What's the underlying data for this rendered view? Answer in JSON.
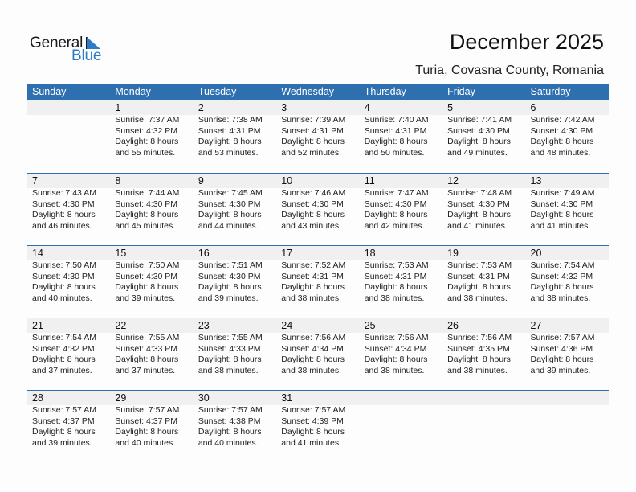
{
  "logo": {
    "word1": "General",
    "word2": "Blue"
  },
  "header": {
    "title": "December 2025",
    "location": "Turia, Covasna County, Romania"
  },
  "colors": {
    "accent": "#2e6fb0",
    "logo_blue": "#2a7bc8",
    "band": "#f0f0f0"
  },
  "weekdays": [
    "Sunday",
    "Monday",
    "Tuesday",
    "Wednesday",
    "Thursday",
    "Friday",
    "Saturday"
  ],
  "weeks": [
    [
      null,
      {
        "day": "1",
        "sunrise": "Sunrise: 7:37 AM",
        "sunset": "Sunset: 4:32 PM",
        "daylight1": "Daylight: 8 hours",
        "daylight2": "and 55 minutes."
      },
      {
        "day": "2",
        "sunrise": "Sunrise: 7:38 AM",
        "sunset": "Sunset: 4:31 PM",
        "daylight1": "Daylight: 8 hours",
        "daylight2": "and 53 minutes."
      },
      {
        "day": "3",
        "sunrise": "Sunrise: 7:39 AM",
        "sunset": "Sunset: 4:31 PM",
        "daylight1": "Daylight: 8 hours",
        "daylight2": "and 52 minutes."
      },
      {
        "day": "4",
        "sunrise": "Sunrise: 7:40 AM",
        "sunset": "Sunset: 4:31 PM",
        "daylight1": "Daylight: 8 hours",
        "daylight2": "and 50 minutes."
      },
      {
        "day": "5",
        "sunrise": "Sunrise: 7:41 AM",
        "sunset": "Sunset: 4:30 PM",
        "daylight1": "Daylight: 8 hours",
        "daylight2": "and 49 minutes."
      },
      {
        "day": "6",
        "sunrise": "Sunrise: 7:42 AM",
        "sunset": "Sunset: 4:30 PM",
        "daylight1": "Daylight: 8 hours",
        "daylight2": "and 48 minutes."
      }
    ],
    [
      {
        "day": "7",
        "sunrise": "Sunrise: 7:43 AM",
        "sunset": "Sunset: 4:30 PM",
        "daylight1": "Daylight: 8 hours",
        "daylight2": "and 46 minutes."
      },
      {
        "day": "8",
        "sunrise": "Sunrise: 7:44 AM",
        "sunset": "Sunset: 4:30 PM",
        "daylight1": "Daylight: 8 hours",
        "daylight2": "and 45 minutes."
      },
      {
        "day": "9",
        "sunrise": "Sunrise: 7:45 AM",
        "sunset": "Sunset: 4:30 PM",
        "daylight1": "Daylight: 8 hours",
        "daylight2": "and 44 minutes."
      },
      {
        "day": "10",
        "sunrise": "Sunrise: 7:46 AM",
        "sunset": "Sunset: 4:30 PM",
        "daylight1": "Daylight: 8 hours",
        "daylight2": "and 43 minutes."
      },
      {
        "day": "11",
        "sunrise": "Sunrise: 7:47 AM",
        "sunset": "Sunset: 4:30 PM",
        "daylight1": "Daylight: 8 hours",
        "daylight2": "and 42 minutes."
      },
      {
        "day": "12",
        "sunrise": "Sunrise: 7:48 AM",
        "sunset": "Sunset: 4:30 PM",
        "daylight1": "Daylight: 8 hours",
        "daylight2": "and 41 minutes."
      },
      {
        "day": "13",
        "sunrise": "Sunrise: 7:49 AM",
        "sunset": "Sunset: 4:30 PM",
        "daylight1": "Daylight: 8 hours",
        "daylight2": "and 41 minutes."
      }
    ],
    [
      {
        "day": "14",
        "sunrise": "Sunrise: 7:50 AM",
        "sunset": "Sunset: 4:30 PM",
        "daylight1": "Daylight: 8 hours",
        "daylight2": "and 40 minutes."
      },
      {
        "day": "15",
        "sunrise": "Sunrise: 7:50 AM",
        "sunset": "Sunset: 4:30 PM",
        "daylight1": "Daylight: 8 hours",
        "daylight2": "and 39 minutes."
      },
      {
        "day": "16",
        "sunrise": "Sunrise: 7:51 AM",
        "sunset": "Sunset: 4:30 PM",
        "daylight1": "Daylight: 8 hours",
        "daylight2": "and 39 minutes."
      },
      {
        "day": "17",
        "sunrise": "Sunrise: 7:52 AM",
        "sunset": "Sunset: 4:31 PM",
        "daylight1": "Daylight: 8 hours",
        "daylight2": "and 38 minutes."
      },
      {
        "day": "18",
        "sunrise": "Sunrise: 7:53 AM",
        "sunset": "Sunset: 4:31 PM",
        "daylight1": "Daylight: 8 hours",
        "daylight2": "and 38 minutes."
      },
      {
        "day": "19",
        "sunrise": "Sunrise: 7:53 AM",
        "sunset": "Sunset: 4:31 PM",
        "daylight1": "Daylight: 8 hours",
        "daylight2": "and 38 minutes."
      },
      {
        "day": "20",
        "sunrise": "Sunrise: 7:54 AM",
        "sunset": "Sunset: 4:32 PM",
        "daylight1": "Daylight: 8 hours",
        "daylight2": "and 38 minutes."
      }
    ],
    [
      {
        "day": "21",
        "sunrise": "Sunrise: 7:54 AM",
        "sunset": "Sunset: 4:32 PM",
        "daylight1": "Daylight: 8 hours",
        "daylight2": "and 37 minutes."
      },
      {
        "day": "22",
        "sunrise": "Sunrise: 7:55 AM",
        "sunset": "Sunset: 4:33 PM",
        "daylight1": "Daylight: 8 hours",
        "daylight2": "and 37 minutes."
      },
      {
        "day": "23",
        "sunrise": "Sunrise: 7:55 AM",
        "sunset": "Sunset: 4:33 PM",
        "daylight1": "Daylight: 8 hours",
        "daylight2": "and 38 minutes."
      },
      {
        "day": "24",
        "sunrise": "Sunrise: 7:56 AM",
        "sunset": "Sunset: 4:34 PM",
        "daylight1": "Daylight: 8 hours",
        "daylight2": "and 38 minutes."
      },
      {
        "day": "25",
        "sunrise": "Sunrise: 7:56 AM",
        "sunset": "Sunset: 4:34 PM",
        "daylight1": "Daylight: 8 hours",
        "daylight2": "and 38 minutes."
      },
      {
        "day": "26",
        "sunrise": "Sunrise: 7:56 AM",
        "sunset": "Sunset: 4:35 PM",
        "daylight1": "Daylight: 8 hours",
        "daylight2": "and 38 minutes."
      },
      {
        "day": "27",
        "sunrise": "Sunrise: 7:57 AM",
        "sunset": "Sunset: 4:36 PM",
        "daylight1": "Daylight: 8 hours",
        "daylight2": "and 39 minutes."
      }
    ],
    [
      {
        "day": "28",
        "sunrise": "Sunrise: 7:57 AM",
        "sunset": "Sunset: 4:37 PM",
        "daylight1": "Daylight: 8 hours",
        "daylight2": "and 39 minutes."
      },
      {
        "day": "29",
        "sunrise": "Sunrise: 7:57 AM",
        "sunset": "Sunset: 4:37 PM",
        "daylight1": "Daylight: 8 hours",
        "daylight2": "and 40 minutes."
      },
      {
        "day": "30",
        "sunrise": "Sunrise: 7:57 AM",
        "sunset": "Sunset: 4:38 PM",
        "daylight1": "Daylight: 8 hours",
        "daylight2": "and 40 minutes."
      },
      {
        "day": "31",
        "sunrise": "Sunrise: 7:57 AM",
        "sunset": "Sunset: 4:39 PM",
        "daylight1": "Daylight: 8 hours",
        "daylight2": "and 41 minutes."
      },
      null,
      null,
      null
    ]
  ]
}
